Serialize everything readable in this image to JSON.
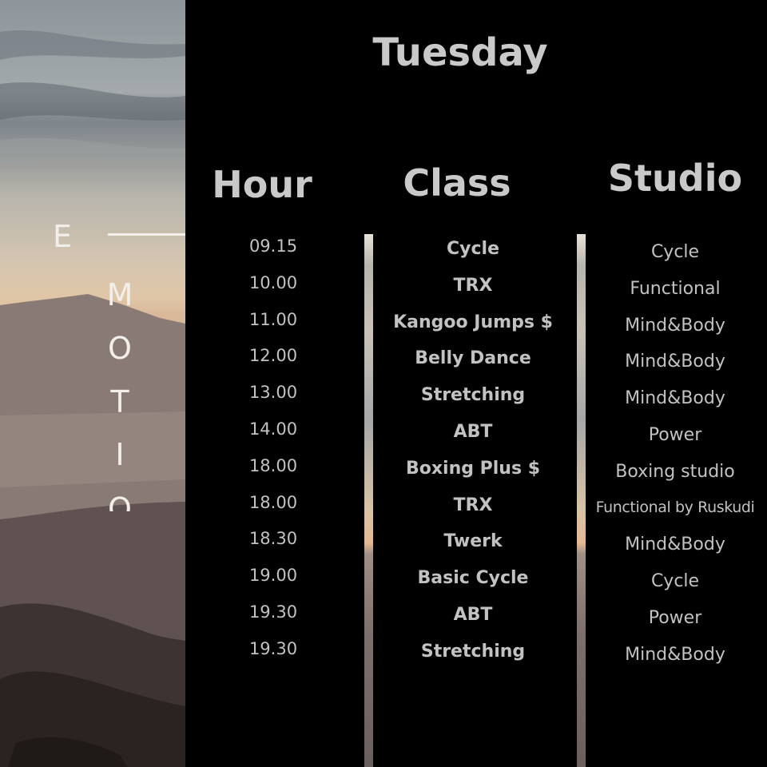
{
  "brand": {
    "letters": [
      "E",
      "M",
      "O",
      "T",
      "I",
      "O"
    ]
  },
  "schedule": {
    "day": "Tuesday",
    "headers": {
      "hour": "Hour",
      "class": "Class",
      "studio": "Studio"
    },
    "rows": [
      {
        "hour": "09.15",
        "class": "Cycle",
        "studio": "Cycle"
      },
      {
        "hour": "10.00",
        "class": "TRX",
        "studio": "Functional"
      },
      {
        "hour": "11.00",
        "class": "Kangoo Jumps $",
        "studio": "Mind&Body"
      },
      {
        "hour": "12.00",
        "class": "Belly Dance",
        "studio": "Mind&Body"
      },
      {
        "hour": "13.00",
        "class": "Stretching",
        "studio": "Mind&Body"
      },
      {
        "hour": "14.00",
        "class": "ABT",
        "studio": "Power"
      },
      {
        "hour": "18.00",
        "class": "Boxing Plus $",
        "studio": "Boxing studio"
      },
      {
        "hour": "18.00",
        "class": "TRX",
        "studio": "Functional by Ruskudi"
      },
      {
        "hour": "18.30",
        "class": "Twerk",
        "studio": "Mind&Body"
      },
      {
        "hour": "19.00",
        "class": "Basic Cycle",
        "studio": "Cycle"
      },
      {
        "hour": "19.30",
        "class": "ABT",
        "studio": "Power"
      },
      {
        "hour": "19.30",
        "class": "Stretching",
        "studio": "Mind&Body"
      }
    ]
  }
}
